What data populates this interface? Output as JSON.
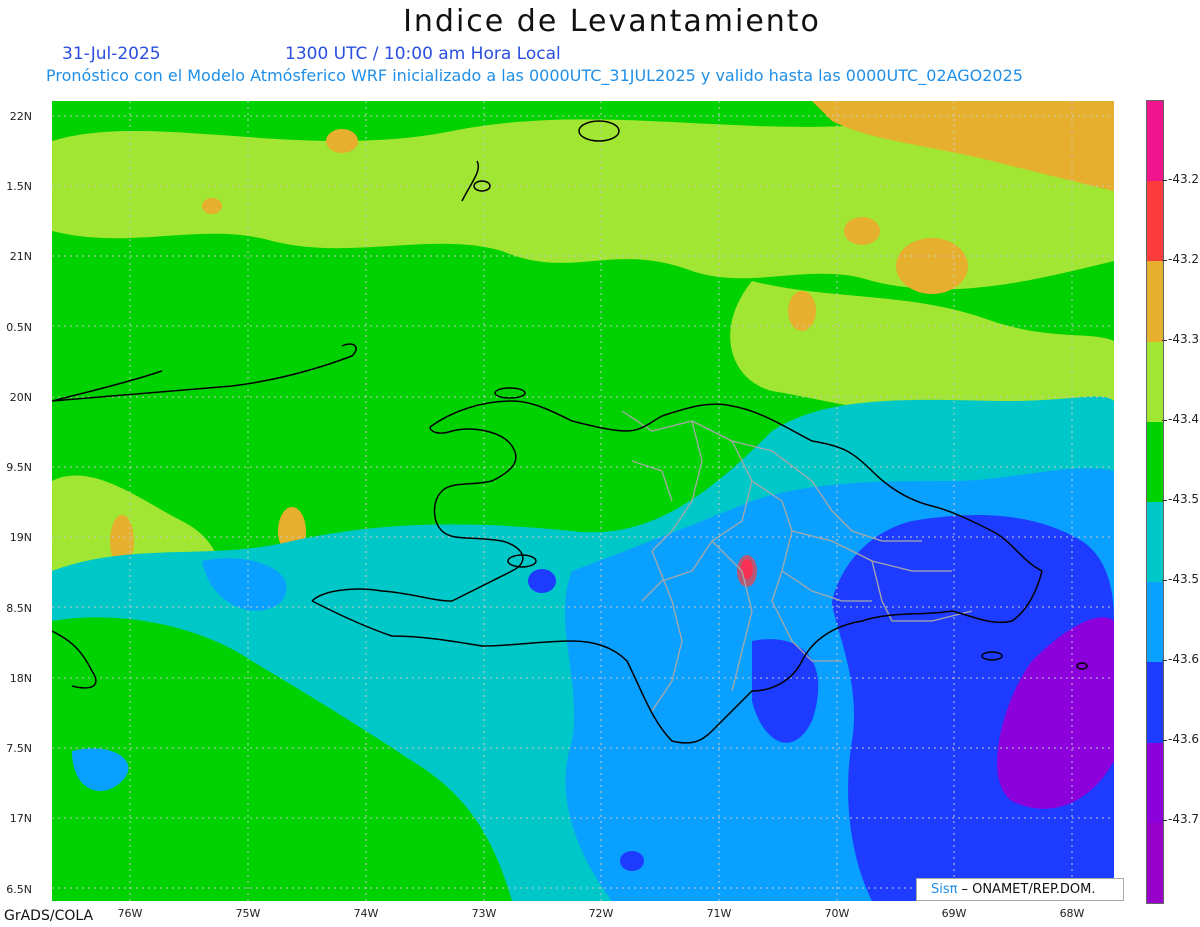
{
  "header": {
    "title": "Indice de Levantamiento",
    "date": "31-Jul-2025",
    "time": "1300 UTC / 10:00 am Hora Local",
    "forecast": "Pronóstico con el Modelo Atmósferico WRF inicializado a las 0000UTC_31JUL2025 y valido hasta las  0000UTC_02AGO2025"
  },
  "map": {
    "lat_labels": [
      "22N",
      "1.5N",
      "21N",
      "0.5N",
      "20N",
      "9.5N",
      "19N",
      "8.5N",
      "18N",
      "7.5N",
      "17N",
      "6.5N"
    ],
    "lon_labels": [
      "76W",
      "75W",
      "74W",
      "73W",
      "72W",
      "71W",
      "70W",
      "69W",
      "68W"
    ],
    "colors": {
      "land": "#00d100",
      "ocean_light": "#00c8c8",
      "ocean_medium": "#0aa0ff",
      "ocean_deep": "#1e3cff",
      "violet": "#8c00dc",
      "lime": "#a0e632",
      "orange": "#e6af2d",
      "coast": "#000000",
      "provinces": "#a8a8a8"
    }
  },
  "colorbar": {
    "labels": [
      "-43.2",
      "-43.2",
      "-43.3",
      "-43.4",
      "-43.5",
      "-43.5",
      "-43.6",
      "-43.6",
      "-43.7"
    ],
    "colors": [
      "#f0148c",
      "#fa3c3c",
      "#e6af2d",
      "#a0e632",
      "#00d100",
      "#00c8c8",
      "#0aa0ff",
      "#1e3cff",
      "#8c00dc",
      "#9600c8"
    ]
  },
  "footer": {
    "credit": "GrADS/COLA",
    "logo_mark": "Sisπ",
    "logo_text": "– ONAMET/REP.DOM."
  }
}
